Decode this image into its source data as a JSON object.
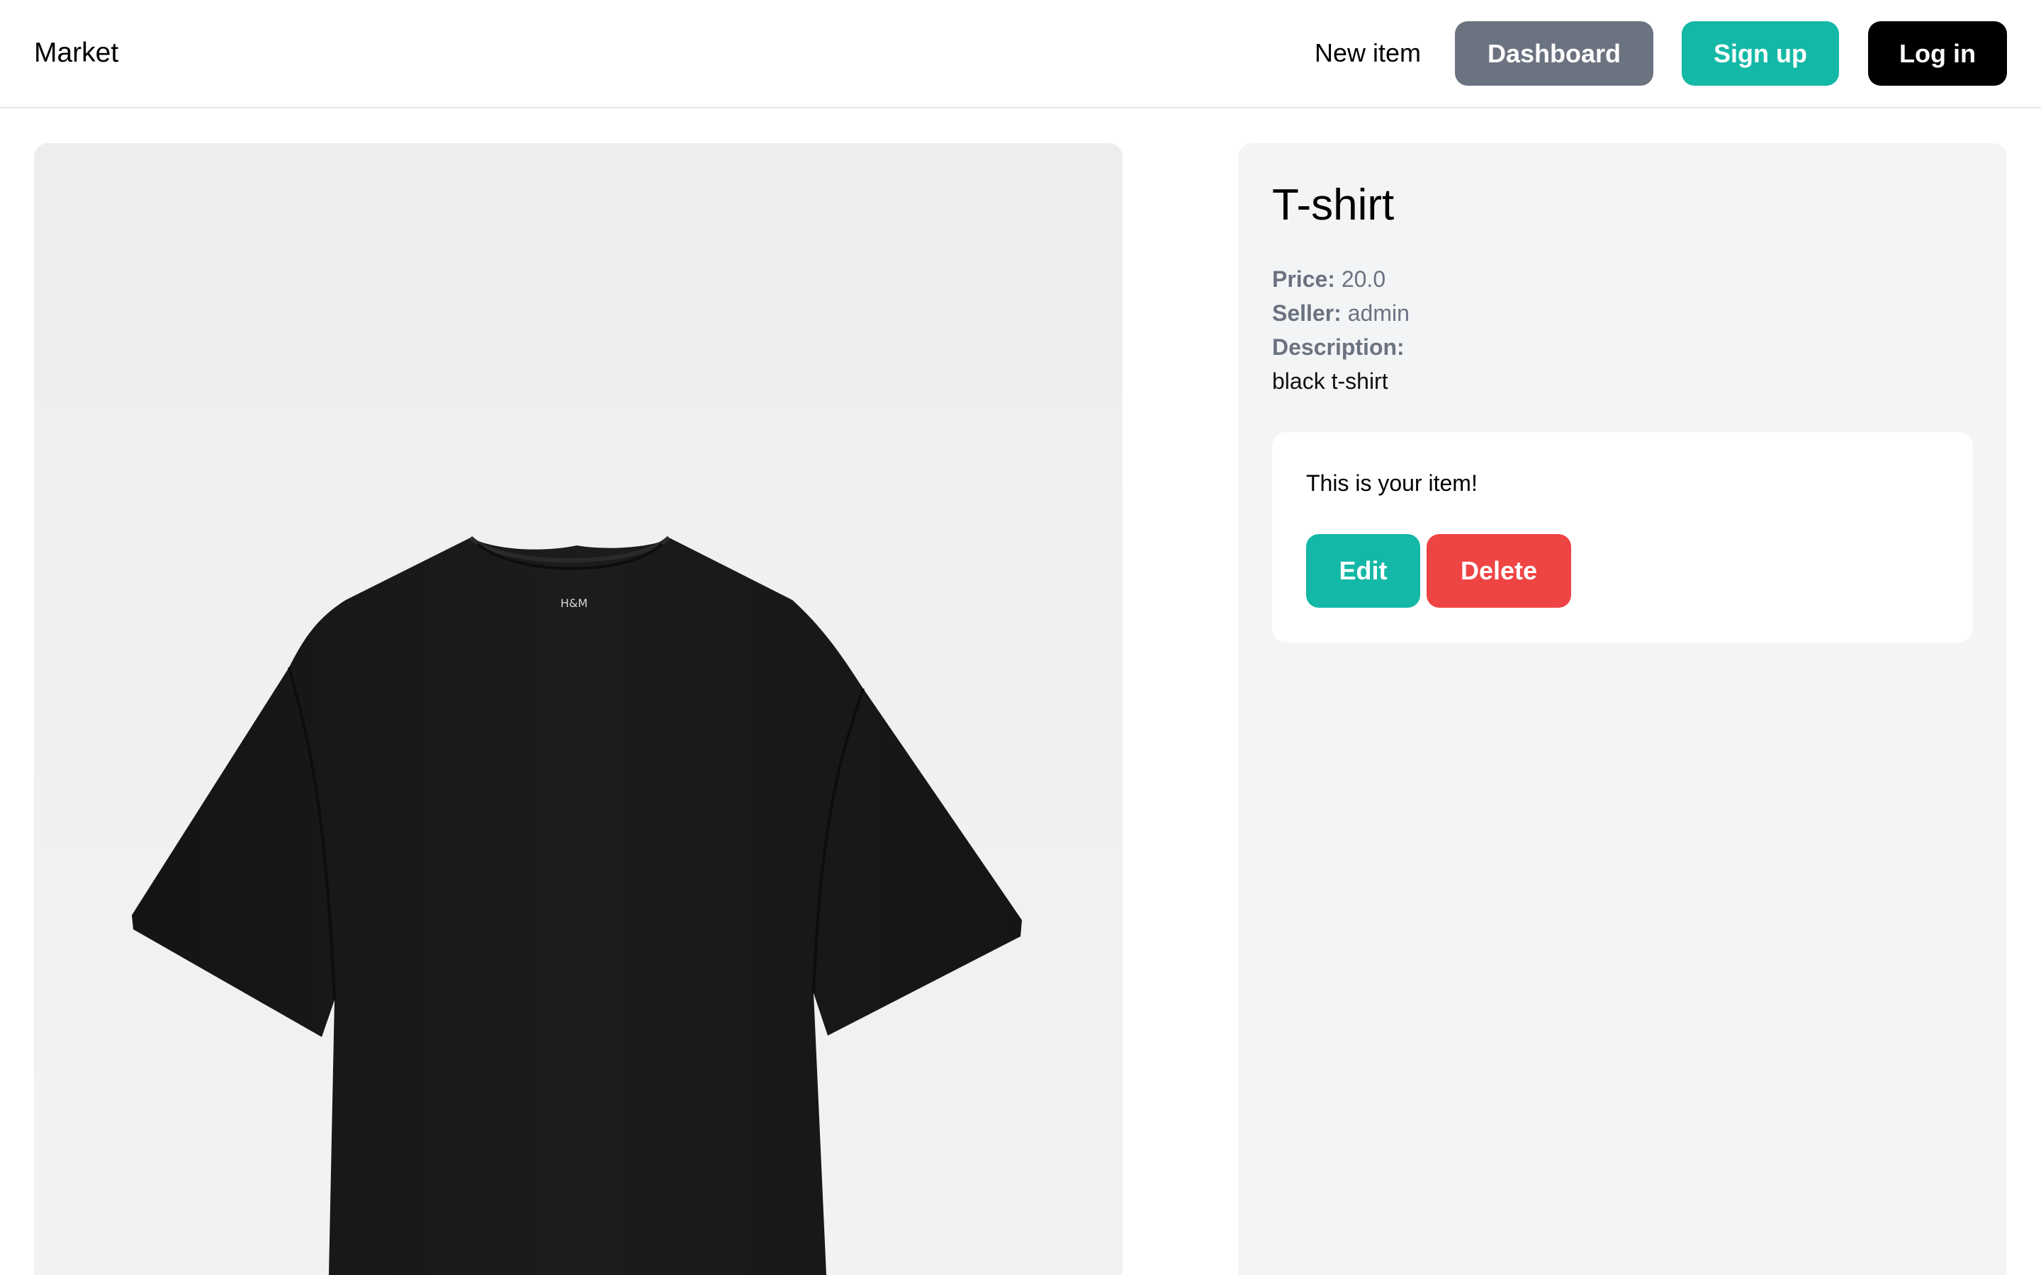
{
  "navbar": {
    "brand": "Market",
    "new_item_label": "New item",
    "dashboard_label": "Dashboard",
    "signup_label": "Sign up",
    "login_label": "Log in"
  },
  "item": {
    "title": "T-shirt",
    "price_label": "Price:",
    "price_value": "20.0",
    "seller_label": "Seller:",
    "seller_value": "admin",
    "description_label": "Description:",
    "description_value": "black t-shirt",
    "image_semantic": "black-tshirt-photo",
    "tshirt_tag_text": "H&M"
  },
  "owner_card": {
    "message": "This is your item!",
    "edit_label": "Edit",
    "delete_label": "Delete"
  },
  "colors": {
    "teal": "#14b8a6",
    "gray_button": "#6b7280",
    "red": "#ef4444",
    "black": "#000000",
    "panel_bg": "#f3f4f6"
  }
}
